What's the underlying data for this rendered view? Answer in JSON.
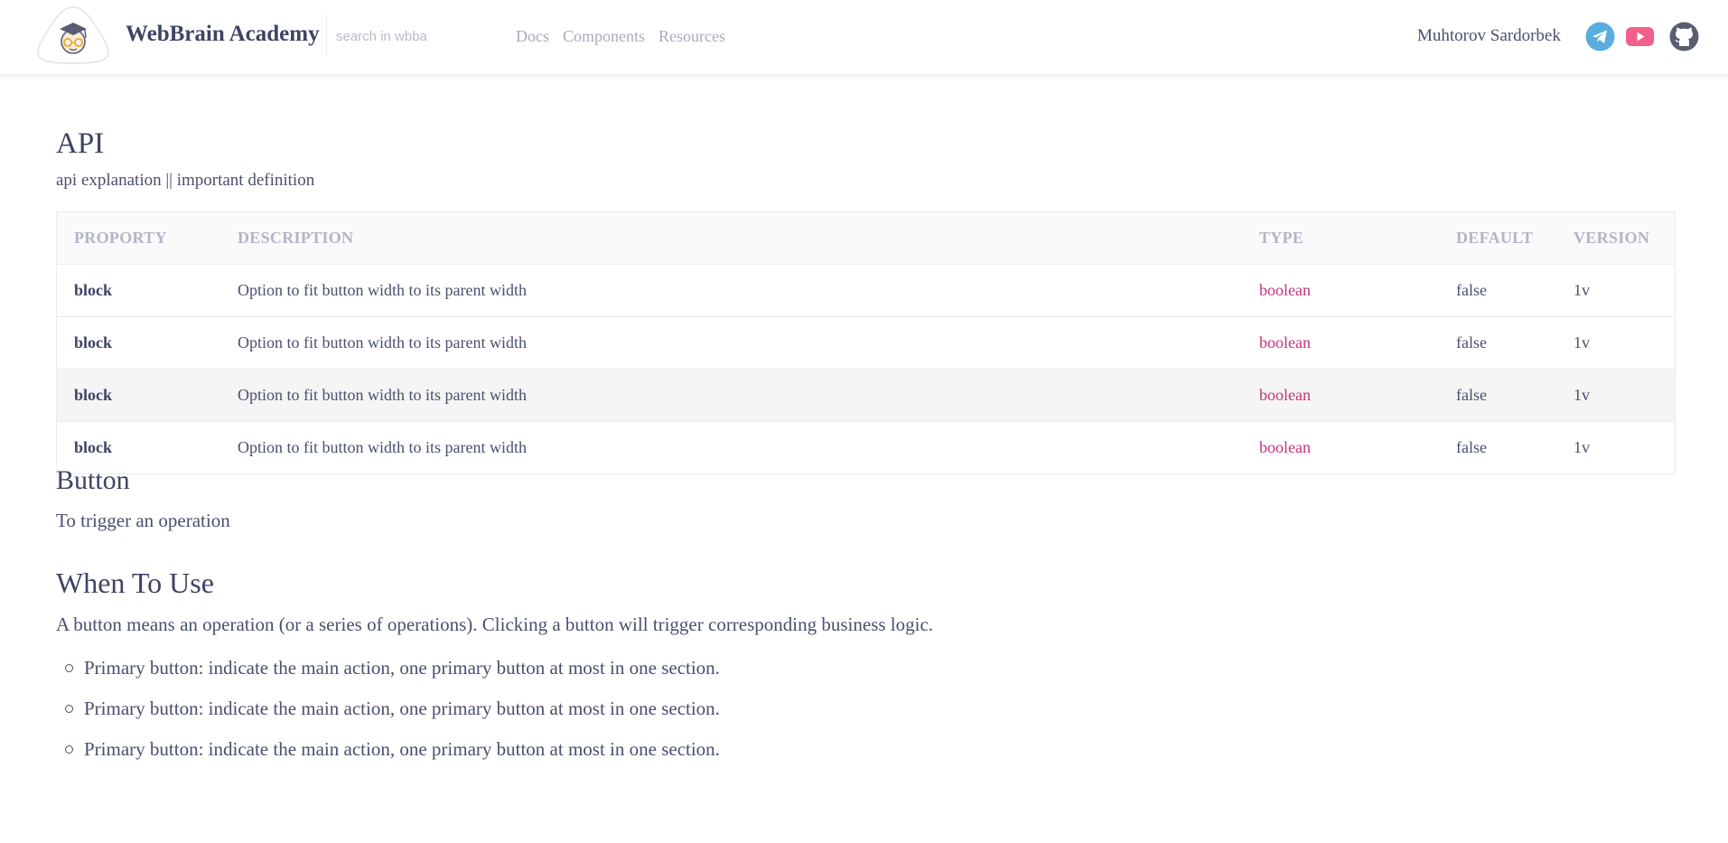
{
  "header": {
    "brand": "WebBrain Academy",
    "search_placeholder": "search in wbba",
    "nav": [
      "Docs",
      "Components",
      "Resources"
    ],
    "user_name": "Muhtorov Sardorbek",
    "social": [
      "telegram-icon",
      "youtube-icon",
      "github-icon"
    ],
    "colors": {
      "telegram": "#5aaede",
      "youtube": "#f25f8a",
      "github": "#5a5d72"
    }
  },
  "api": {
    "title": "API",
    "subtitle": "api explanation || important definition",
    "columns": [
      "PROPORTY",
      "DESCRIPTION",
      "TYPE",
      "DEFAULT",
      "VERSION"
    ],
    "rows": [
      {
        "property": "block",
        "description": "Option to fit button width to its parent width",
        "type": "boolean",
        "default": "false",
        "version": "1v"
      },
      {
        "property": "block",
        "description": "Option to fit button width to its parent width",
        "type": "boolean",
        "default": "false",
        "version": "1v"
      },
      {
        "property": "block",
        "description": "Option to fit button width to its parent width",
        "type": "boolean",
        "default": "false",
        "version": "1v"
      },
      {
        "property": "block",
        "description": "Option to fit button width to its parent width",
        "type": "boolean",
        "default": "false",
        "version": "1v"
      }
    ]
  },
  "button_section": {
    "title": "Button",
    "subtitle": "To trigger an operation"
  },
  "when_to_use": {
    "title": "When To Use",
    "paragraph": "A button means an operation (or a series of operations). Clicking a button will trigger corresponding business logic.",
    "items": [
      "Primary button: indicate the main action, one primary button at most in one section.",
      "Primary button: indicate the main action, one primary button at most in one section.",
      "Primary button: indicate the main action, one primary button at most in one section."
    ]
  }
}
